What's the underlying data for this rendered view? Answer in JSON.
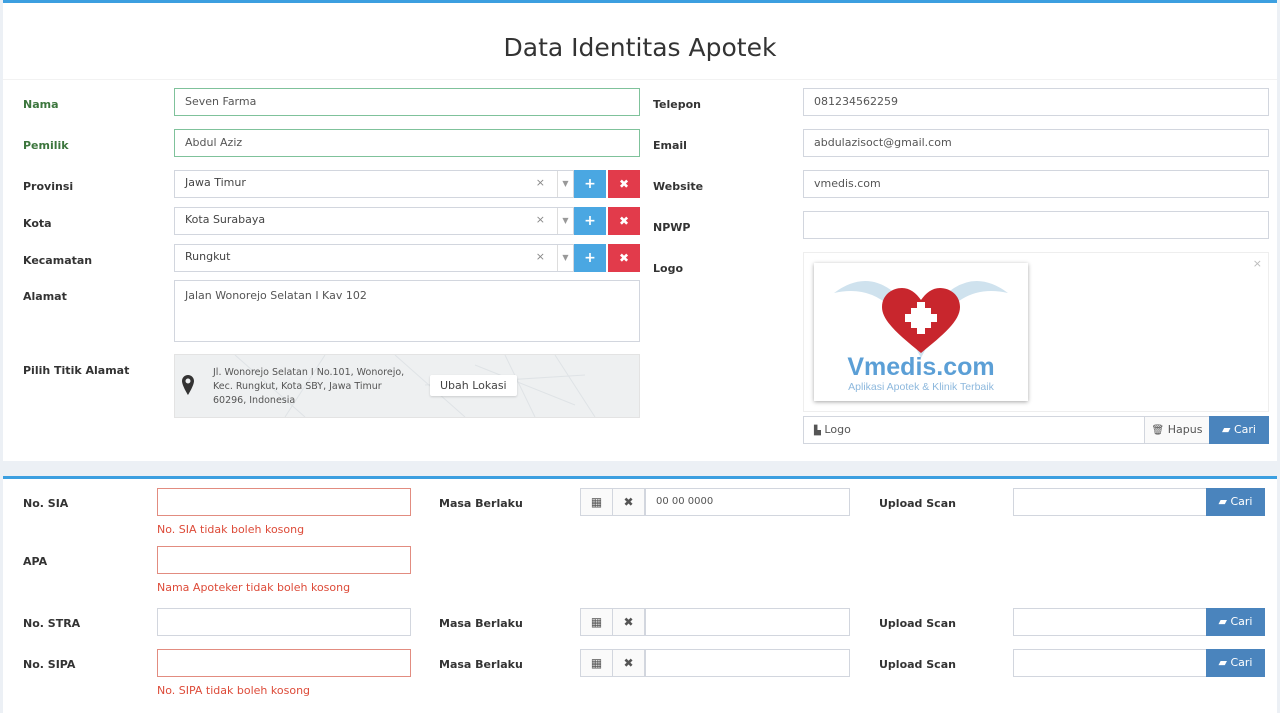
{
  "page": {
    "title": "Data Identitas Apotek"
  },
  "left": {
    "nama": {
      "label": "Nama",
      "value": "Seven Farma"
    },
    "pemilik": {
      "label": "Pemilik",
      "value": "Abdul Aziz"
    },
    "provinsi": {
      "label": "Provinsi",
      "value": "Jawa Timur"
    },
    "kota": {
      "label": "Kota",
      "value": "Kota Surabaya"
    },
    "kecamatan": {
      "label": "Kecamatan",
      "value": "Rungkut"
    },
    "alamat": {
      "label": "Alamat",
      "value": "Jalan Wonorejo Selatan I Kav 102"
    },
    "titik": {
      "label": "Pilih Titik Alamat",
      "address": "Jl. Wonorejo Selatan I No.101, Wonorejo, Kec. Rungkut, Kota SBY, Jawa Timur 60296, Indonesia",
      "button": "Ubah Lokasi"
    }
  },
  "right": {
    "telepon": {
      "label": "Telepon",
      "value": "081234562259"
    },
    "email": {
      "label": "Email",
      "value": "abdulazisoct@gmail.com"
    },
    "website": {
      "label": "Website",
      "value": "vmedis.com"
    },
    "npwp": {
      "label": "NPWP",
      "value": ""
    },
    "logo": {
      "label": "Logo",
      "file": "Logo",
      "hapus": "Hapus",
      "cari": "Cari",
      "brand": "Vmedis.com",
      "tagline": "Aplikasi Apotek & Klinik Terbaik"
    }
  },
  "glyphs": {
    "clear": "×",
    "caret": "▼",
    "plus": "+",
    "remove": "✖",
    "calendar": "▦",
    "file": "▙",
    "trash": "🗑",
    "folder": "▰",
    "pin": "●"
  },
  "licenses": [
    {
      "label": "No. SIA",
      "value": "",
      "error": "No. SIA tidak boleh kosong",
      "masa": "Masa Berlaku",
      "date": "00 00 0000",
      "upload": "Upload Scan",
      "cari": "Cari"
    },
    {
      "label": "APA",
      "value": "",
      "error": "Nama Apoteker tidak boleh kosong"
    },
    {
      "label": "No. STRA",
      "value": "",
      "masa": "Masa Berlaku",
      "date": "",
      "upload": "Upload Scan",
      "cari": "Cari"
    },
    {
      "label": "No. SIPA",
      "value": "",
      "error": "No. SIPA tidak boleh kosong",
      "masa": "Masa Berlaku",
      "date": "",
      "upload": "Upload Scan",
      "cari": "Cari"
    }
  ],
  "colors": {
    "accent": "#3c9fe0",
    "danger": "#e23b4b",
    "primary": "#4a84bd",
    "success": "#3c763d"
  }
}
